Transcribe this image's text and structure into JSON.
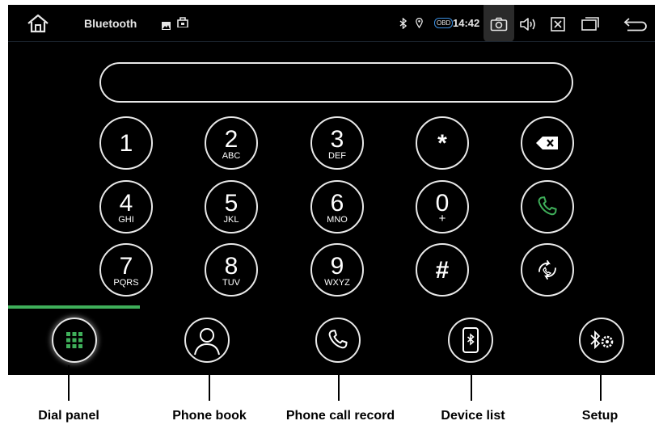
{
  "status_bar": {
    "title": "Bluetooth",
    "obd": "OBD",
    "time": "14:42",
    "icons": [
      "home-icon",
      "image-icon",
      "bag-icon",
      "bluetooth-icon",
      "location-icon",
      "camera-icon",
      "volume-icon",
      "close-box-icon",
      "windows-icon",
      "back-icon"
    ]
  },
  "dialer": {
    "number_value": "",
    "keys": [
      {
        "digit": "1",
        "letters": ""
      },
      {
        "digit": "2",
        "letters": "ABC"
      },
      {
        "digit": "3",
        "letters": "DEF"
      },
      {
        "digit": "*",
        "letters": ""
      },
      {
        "digit": "4",
        "letters": "GHI"
      },
      {
        "digit": "5",
        "letters": "JKL"
      },
      {
        "digit": "6",
        "letters": "MNO"
      },
      {
        "digit": "0",
        "letters": "+"
      },
      {
        "digit": "7",
        "letters": "PQRS"
      },
      {
        "digit": "8",
        "letters": "TUV"
      },
      {
        "digit": "9",
        "letters": "WXYZ"
      },
      {
        "digit": "#",
        "letters": ""
      }
    ],
    "actions": [
      "backspace-icon",
      "call-icon",
      "sync-icon"
    ],
    "call_color": "#3faf5a"
  },
  "nav": {
    "items": [
      {
        "label": "Dial panel",
        "icon": "keypad-icon"
      },
      {
        "label": "Phone book",
        "icon": "contact-icon"
      },
      {
        "label": "Phone call record",
        "icon": "phone-icon"
      },
      {
        "label": "Device list",
        "icon": "device-bluetooth-icon"
      },
      {
        "label": "Setup",
        "icon": "bluetooth-settings-icon"
      }
    ],
    "active_index": 0,
    "accent": "#3faf5a"
  }
}
